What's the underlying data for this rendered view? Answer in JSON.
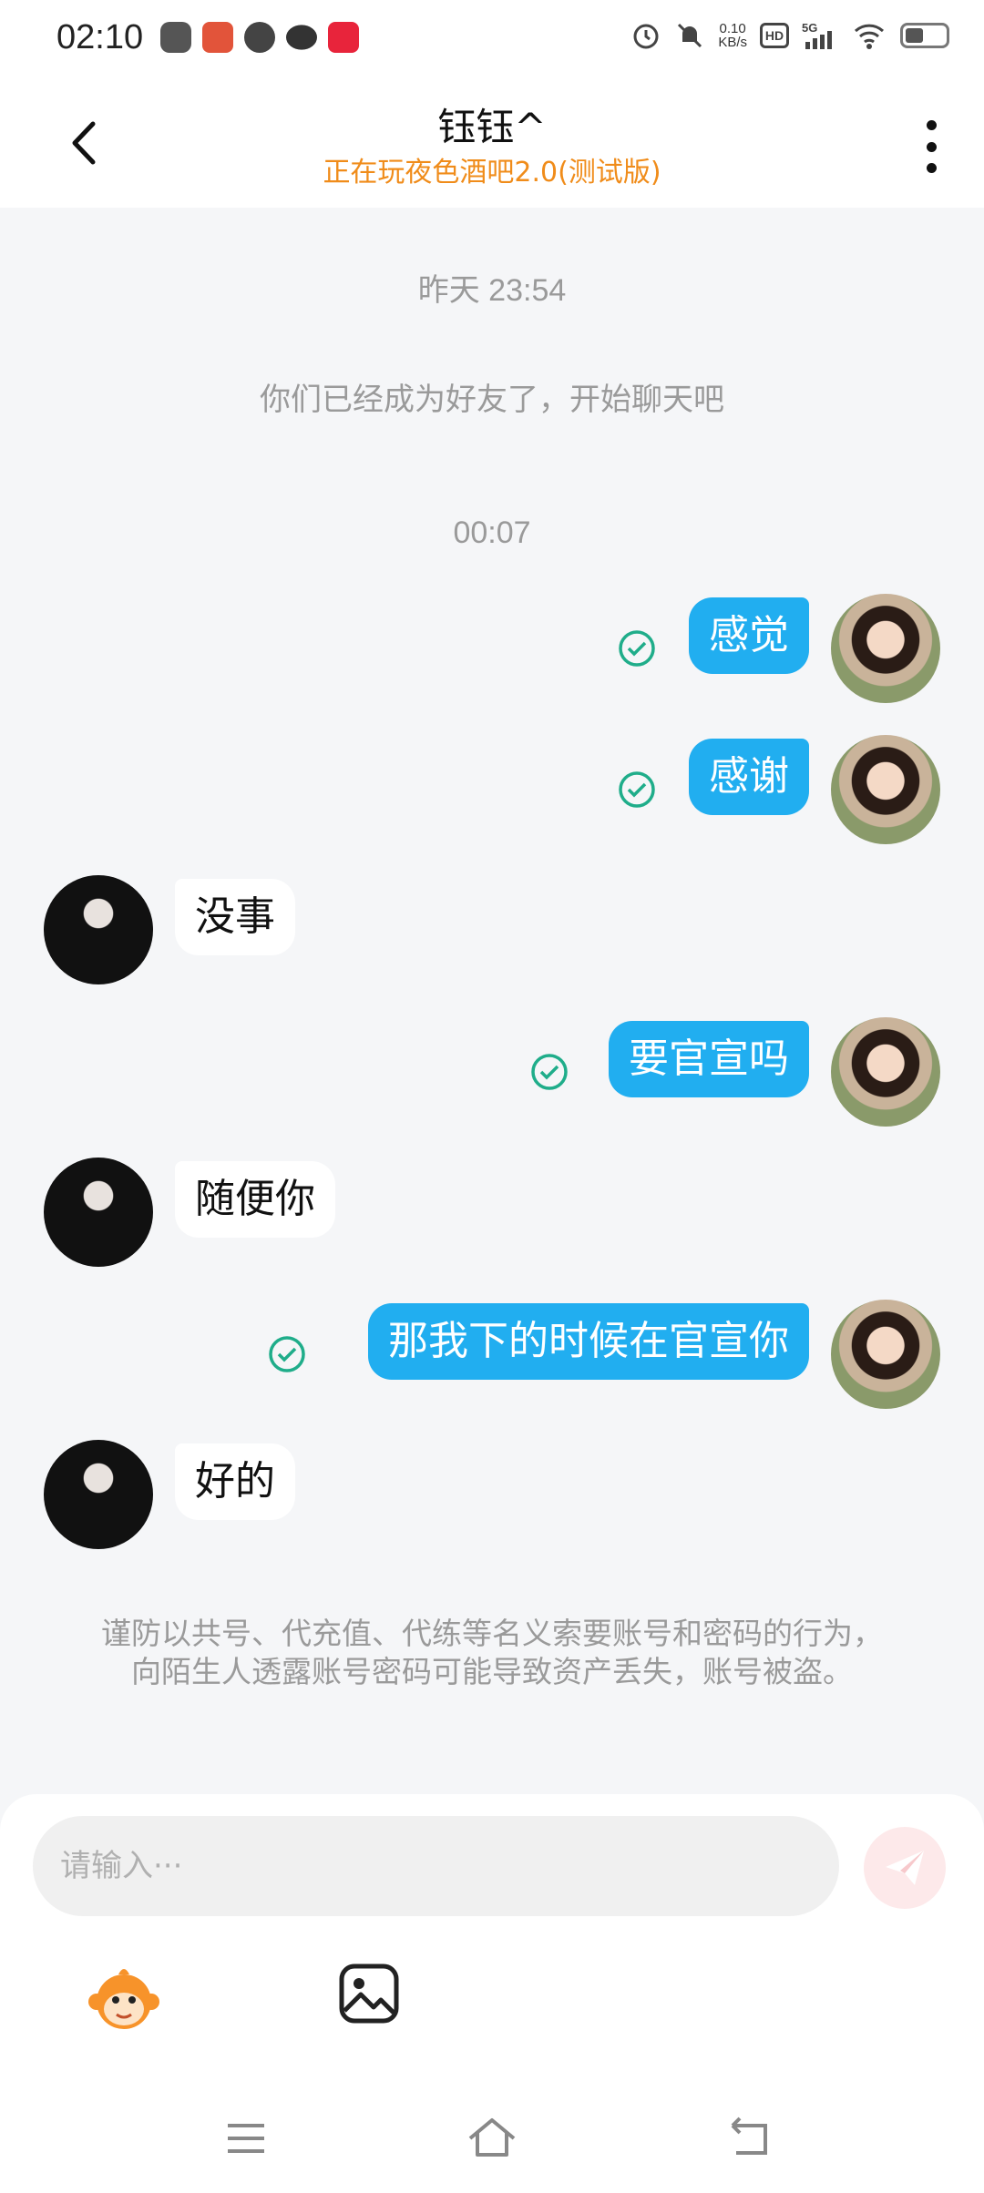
{
  "status_bar": {
    "time": "02:10",
    "net_speed_value": "0.10",
    "net_speed_unit": "KB/s",
    "hd_label": "HD",
    "network": "5G",
    "battery_level": 0.45
  },
  "header": {
    "title": "钰钰^",
    "subtitle": "正在玩夜色酒吧2.0(测试版)"
  },
  "chat": {
    "timestamp_1": "昨天 23:54",
    "system_message": "你们已经成为好友了，开始聊天吧",
    "timestamp_2": "00:07",
    "messages": [
      {
        "sender": "me",
        "text": "感觉",
        "status": "read"
      },
      {
        "sender": "me",
        "text": "感谢",
        "status": "read"
      },
      {
        "sender": "friend",
        "text": "没事"
      },
      {
        "sender": "me",
        "text": "要官宣吗",
        "status": "read"
      },
      {
        "sender": "friend",
        "text": "随便你"
      },
      {
        "sender": "me",
        "text": "那我下的时候在官宣你",
        "status": "read"
      },
      {
        "sender": "friend",
        "text": "好的"
      }
    ],
    "safety_notice": "谨防以共号、代充值、代练等名义索要账号和密码的行为，向陌生人透露账号密码可能导致资产丢失，账号被盗。"
  },
  "composer": {
    "placeholder": "请输入···",
    "value": ""
  },
  "colors": {
    "accent": "#21aef0",
    "subtitle": "#f08c1a",
    "read_check": "#1fad8a"
  },
  "icons": {
    "back": "chevron-left-icon",
    "more": "more-vertical-icon",
    "send": "send-icon",
    "emoji": "monkey-emoji-icon",
    "image": "image-icon",
    "nav_menu": "menu-icon",
    "nav_home": "home-icon",
    "nav_back": "back-arrow-icon"
  }
}
